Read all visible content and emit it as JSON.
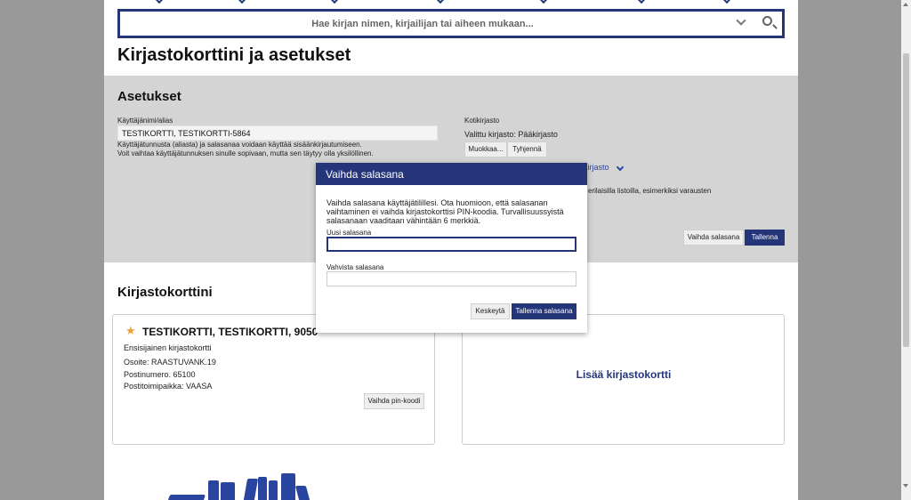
{
  "search": {
    "placeholder": "Hae kirjan nimen, kirjailijan tai aiheen mukaan..."
  },
  "page": {
    "title": "Kirjastokorttini ja asetukset"
  },
  "settings": {
    "heading": "Asetukset",
    "username_label": "Käyttäjänimi/alias",
    "username_value": "TESTIKORTTI, TESTIKORTTI-5864",
    "help_line1": "Käyttäjätunnusta (aliasta) ja salasanaa voidaan käyttää sisäänkirjautumiseen.",
    "help_line2": "Voit vaihtaa käyttäjätunnuksen sinulle sopivaan, mutta sen täytyy olla yksilöllinen.",
    "home_library_label": "Kotikirjasto",
    "home_library_value": "Valittu kirjasto: Pääkirjasto",
    "edit_button": "Muokkaa...",
    "clear_button": "Tyhjennä",
    "partial_link": "kirjasto",
    "partial_text": "erilaisilla listoilla, esimerkiksi varausten",
    "change_password_button": "Vaihda salasana",
    "save_button": "Tallenna"
  },
  "cards": {
    "heading": "Kirjastokorttini",
    "primary": {
      "name": "TESTIKORTTI, TESTIKORTTI, 9050",
      "subtitle": "Ensisijainen kirjastokortti",
      "address": "Osoite: RAASTUVANK.19",
      "postal_code": "Postinumero. 65100",
      "city": "Postitoimipaikka: VAASA",
      "change_pin_button": "Vaihda pin-koodi"
    },
    "add_card": "Lisää kirjastokortti"
  },
  "modal": {
    "title": "Vaihda salasana",
    "description": "Vaihda salasana käyttäjätilillesi. Ota huomioon, että salasanan vaihtaminen ei vaihda kirjastokorttisi PIN-koodia. Turvallisuussyistä salasanaan vaaditaan vähintään 6 merkkiä.",
    "new_password_label": "Uusi salasana",
    "confirm_password_label": "Vahvista salasana",
    "cancel_button": "Keskeytä",
    "save_password_button": "Tallenna salasana"
  },
  "colors": {
    "brand": "#24357a",
    "panel": "#d4d4d4",
    "backdrop": "#999999",
    "star": "#e8a33b"
  },
  "icons": [
    "chevron-down-icon",
    "search-icon",
    "star-icon"
  ]
}
